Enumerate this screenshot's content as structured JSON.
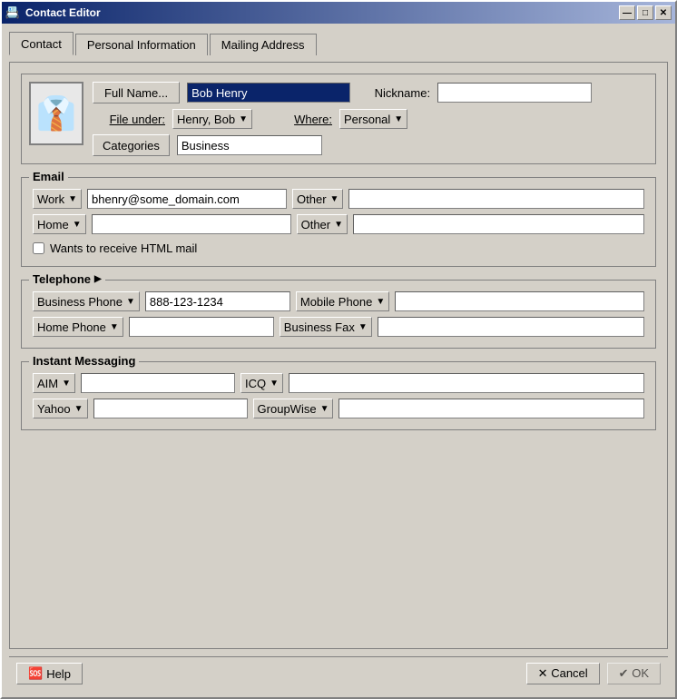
{
  "window": {
    "title": "Contact Editor",
    "icon": "📇"
  },
  "title_buttons": {
    "minimize": "—",
    "maximize": "□",
    "close": "✕"
  },
  "tabs": [
    {
      "label": "Contact",
      "active": true
    },
    {
      "label": "Personal Information",
      "active": false
    },
    {
      "label": "Mailing Address",
      "active": false
    }
  ],
  "contact": {
    "full_name_btn": "Full Name...",
    "full_name_value": "Bob Henry",
    "nickname_label": "Nickname:",
    "nickname_value": "",
    "file_under_label": "File under:",
    "file_under_value": "Henry, Bob",
    "where_label": "Where:",
    "where_value": "Personal",
    "categories_btn": "Categories",
    "categories_value": "Business"
  },
  "email": {
    "section_label": "Email",
    "row1_type": "Work",
    "row1_value": "bhenry@some_domain.com",
    "row1_type2": "Other",
    "row1_value2": "",
    "row2_type": "Home",
    "row2_value": "",
    "row2_type2": "Other",
    "row2_value2": "",
    "html_mail_label": "Wants to receive HTML mail",
    "html_mail_checked": false
  },
  "telephone": {
    "section_label": "Telephone",
    "expand_icon": "▶",
    "row1_type": "Business Phone",
    "row1_value": "888-123-1234",
    "row1_type2": "Mobile Phone",
    "row1_value2": "",
    "row2_type": "Home Phone",
    "row2_value": "",
    "row2_type2": "Business Fax",
    "row2_value2": ""
  },
  "im": {
    "section_label": "Instant Messaging",
    "row1_type": "AIM",
    "row1_value": "",
    "row1_type2": "ICQ",
    "row1_value2": "",
    "row2_type": "Yahoo",
    "row2_value": "",
    "row2_type2": "GroupWise",
    "row2_value2": ""
  },
  "bottom": {
    "help_label": "Help",
    "cancel_label": "Cancel",
    "ok_label": "OK"
  }
}
